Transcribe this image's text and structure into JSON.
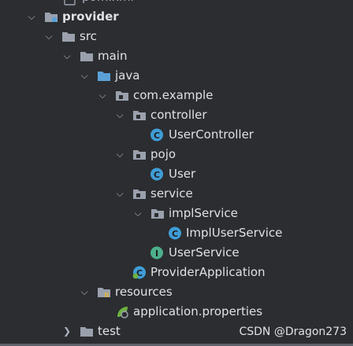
{
  "colors": {
    "background": "#2b2d30",
    "text": "#dfe1e5",
    "folder": "#9aa1ad",
    "source_folder": "#5aa1d8",
    "class_icon": "#3f9dd6",
    "interface_icon": "#4caf8a",
    "spring": "#6db33f"
  },
  "tree": {
    "top_partial_label": "pom.xml",
    "provider": "provider",
    "src": "src",
    "main": "main",
    "java": "java",
    "com_example": "com.example",
    "controller": "controller",
    "user_controller": "UserController",
    "pojo": "pojo",
    "user": "User",
    "service": "service",
    "impl_service": "implService",
    "impl_user_service": "ImplUserService",
    "user_service": "UserService",
    "provider_application": "ProviderApplication",
    "resources": "resources",
    "application_properties": "application.properties",
    "test": "test"
  },
  "icons": {
    "class_letter": "C",
    "interface_letter": "I"
  },
  "watermark": "CSDN @Dragon273"
}
